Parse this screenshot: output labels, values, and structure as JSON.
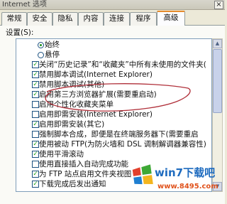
{
  "window": {
    "title": "Internet 选项",
    "close_label": "×"
  },
  "tabs": [
    {
      "label": "常规"
    },
    {
      "label": "安全"
    },
    {
      "label": "隐私"
    },
    {
      "label": "内容"
    },
    {
      "label": "连接"
    },
    {
      "label": "程序"
    },
    {
      "label": "高级"
    }
  ],
  "selected_tab": "高级",
  "settings": {
    "label": "设置(S):",
    "items": [
      {
        "type": "radio",
        "label": "始终",
        "checked": true
      },
      {
        "type": "radio",
        "label": "悬停",
        "checked": false
      },
      {
        "type": "checkbox",
        "label": "关闭“历史记录”和“收藏夹”中所有未使用的文件夹(",
        "checked": true
      },
      {
        "type": "checkbox",
        "label": "禁用脚本调试(Internet Explorer)",
        "checked": true
      },
      {
        "type": "checkbox",
        "label": "禁用脚本调试(其他)",
        "checked": true
      },
      {
        "type": "checkbox",
        "label": "启用第三方浏览器扩展(需要重启动)",
        "checked": true
      },
      {
        "type": "checkbox",
        "label": "启用个性化收藏夹菜单",
        "checked": false
      },
      {
        "type": "checkbox",
        "label": "启用即需安装(Internet Explorer)",
        "checked": false
      },
      {
        "type": "checkbox",
        "label": "启用即需安装(其它)",
        "checked": true
      },
      {
        "type": "checkbox",
        "label": "强制脚本合成，即便是在终端服务器下(需要重启",
        "checked": false
      },
      {
        "type": "checkbox",
        "label": "使用被动 FTP(为防火墙和 DSL 调制解调器兼容性)",
        "checked": true
      },
      {
        "type": "checkbox",
        "label": "使用平滑滚动",
        "checked": true
      },
      {
        "type": "checkbox",
        "label": "使用直接插入自动完成功能",
        "checked": false
      },
      {
        "type": "checkbox",
        "label": "为 FTP 站点启用文件夹视图",
        "checked": true
      },
      {
        "type": "checkbox",
        "label": "下载完成后发出通知",
        "checked": true
      }
    ]
  },
  "scrollbar": {
    "up_glyph": "▲",
    "down_glyph": "▼"
  },
  "annotation": {
    "color": "#b0303a"
  },
  "watermark": {
    "brand": "win7下载吧",
    "url": "www.8495.com",
    "brand_color": "#1e6bbf",
    "url_color": "#e0531d"
  }
}
